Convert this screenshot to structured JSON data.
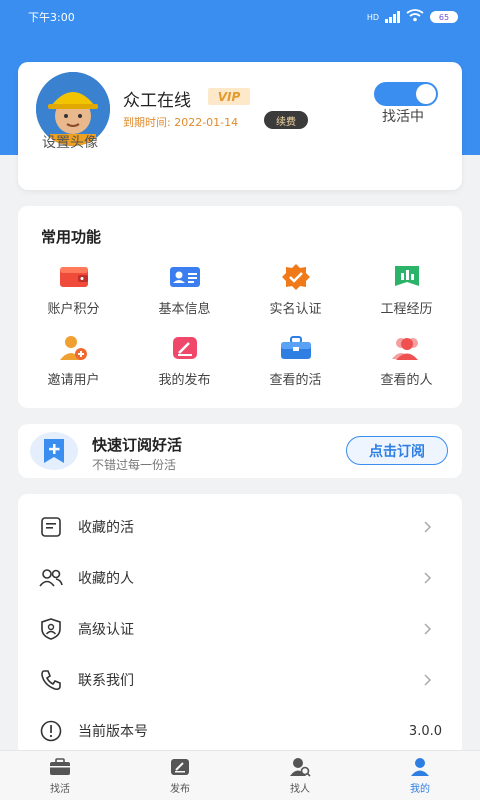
{
  "status_bar": {
    "time": "下午3:00",
    "network": "HD",
    "battery": "65"
  },
  "profile": {
    "avatar_caption": "设置头像",
    "name": "众工在线",
    "vip_badge": "VIP",
    "expire_text": "到期时间: 2022-01-14",
    "renew_label": "续费",
    "toggle_label": "找活中",
    "toggle_on": true
  },
  "functions": {
    "title": "常用功能",
    "items": [
      {
        "label": "账户积分",
        "icon": "wallet-icon"
      },
      {
        "label": "基本信息",
        "icon": "id-card-icon"
      },
      {
        "label": "实名认证",
        "icon": "verified-badge-icon"
      },
      {
        "label": "工程经历",
        "icon": "project-chart-icon"
      },
      {
        "label": "邀请用户",
        "icon": "invite-user-icon"
      },
      {
        "label": "我的发布",
        "icon": "my-posts-icon"
      },
      {
        "label": "查看的活",
        "icon": "toolbox-icon"
      },
      {
        "label": "查看的人",
        "icon": "people-icon"
      }
    ]
  },
  "subscribe": {
    "title": "快速订阅好活",
    "subtitle": "不错过每一份活",
    "button_label": "点击订阅"
  },
  "menu": {
    "items": [
      {
        "label": "收藏的活",
        "icon": "document-icon",
        "value": ""
      },
      {
        "label": "收藏的人",
        "icon": "people-outline-icon",
        "value": ""
      },
      {
        "label": "高级认证",
        "icon": "shield-icon",
        "value": ""
      },
      {
        "label": "联系我们",
        "icon": "phone-icon",
        "value": ""
      },
      {
        "label": "当前版本号",
        "icon": "info-icon",
        "value": "3.0.0"
      }
    ]
  },
  "tabs": [
    {
      "label": "找活",
      "icon": "briefcase-icon",
      "active": false
    },
    {
      "label": "发布",
      "icon": "edit-icon",
      "active": false
    },
    {
      "label": "找人",
      "icon": "find-person-icon",
      "active": false
    },
    {
      "label": "我的",
      "icon": "profile-icon",
      "active": true
    }
  ],
  "colors": {
    "primary": "#3a8ef0",
    "accent_orange": "#e08b2d",
    "vip_bg": "#fde9c9"
  }
}
